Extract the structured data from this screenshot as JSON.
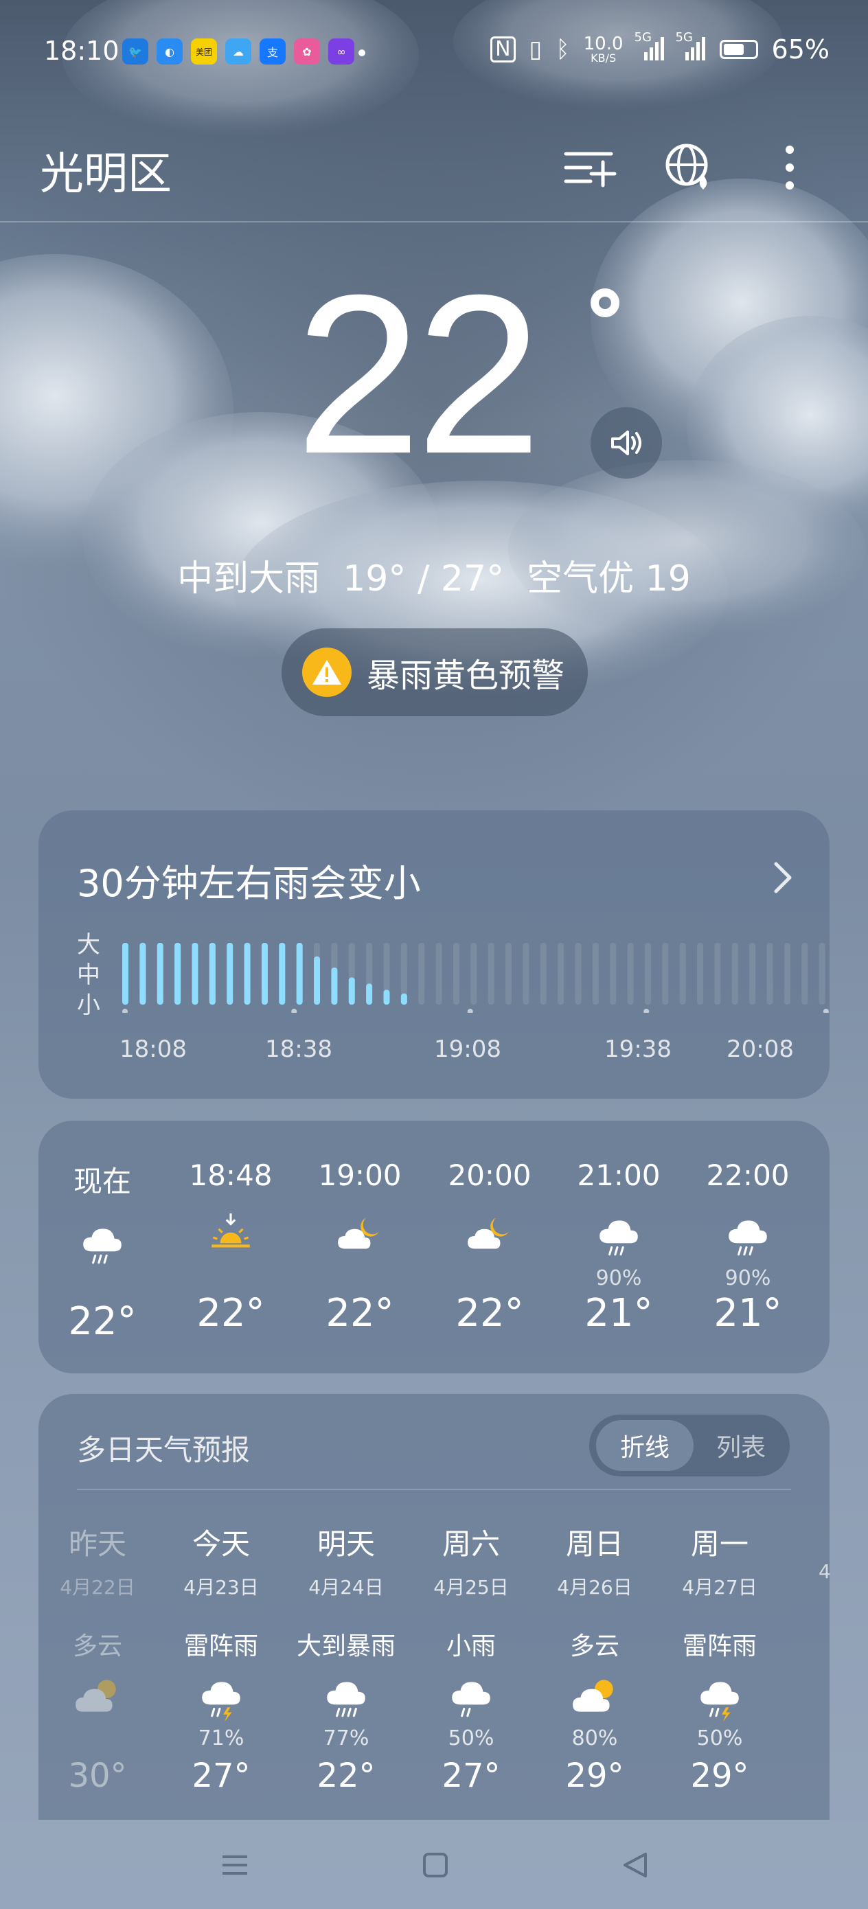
{
  "status": {
    "time": "18:10",
    "apps": [
      {
        "name": "bird-app-icon",
        "color": "#1f7ae0",
        "glyph": "🐦"
      },
      {
        "name": "browser-app-icon",
        "color": "#2a8bf2",
        "glyph": "◐"
      },
      {
        "name": "meituan-app-icon",
        "color": "#f6d000",
        "glyph": "美团"
      },
      {
        "name": "weather-app-icon",
        "color": "#3fa6f3",
        "glyph": "☁"
      },
      {
        "name": "alipay-app-icon",
        "color": "#1677ff",
        "glyph": "支"
      },
      {
        "name": "gallery-app-icon",
        "color": "#e95b9b",
        "glyph": "✿"
      },
      {
        "name": "video-app-icon",
        "color": "#7b3fe4",
        "glyph": "∞"
      }
    ],
    "net_speed_value": "10.0",
    "net_speed_unit": "KB/S",
    "sig1": "5G",
    "sig2": "5G",
    "battery": "65%",
    "battery_level": 0.65
  },
  "header": {
    "city": "光明区"
  },
  "current": {
    "temp": "22",
    "summary": "中到大雨  19° / 27°  空气优 19",
    "alert": "暴雨黄色预警",
    "alert_color": "#f8b81a"
  },
  "rain": {
    "title": "30分钟左右雨会变小",
    "y_labels": [
      "大",
      "中",
      "小"
    ],
    "x_labels": [
      "18:08",
      "18:38",
      "19:08",
      "19:38",
      "20:08"
    ],
    "intensity": [
      1,
      1,
      1,
      1,
      1,
      1,
      1,
      1,
      1,
      1,
      1,
      0.78,
      0.6,
      0.44,
      0.34,
      0.24,
      0.18,
      0,
      0,
      0,
      0,
      0,
      0,
      0,
      0,
      0,
      0,
      0,
      0,
      0,
      0,
      0,
      0,
      0,
      0,
      0,
      0,
      0,
      0,
      0,
      0
    ],
    "bar_color": "#8fdcff"
  },
  "hourly": [
    {
      "time": "现在",
      "icon": "rain-cloud",
      "precip": "",
      "temp": "22°"
    },
    {
      "time": "18:48",
      "icon": "sunset",
      "precip": "",
      "temp": "22°"
    },
    {
      "time": "19:00",
      "icon": "cloudy-night",
      "precip": "",
      "temp": "22°"
    },
    {
      "time": "20:00",
      "icon": "cloudy-night",
      "precip": "",
      "temp": "22°"
    },
    {
      "time": "21:00",
      "icon": "rain-cloud",
      "precip": "90%",
      "temp": "21°"
    },
    {
      "time": "22:00",
      "icon": "rain-cloud",
      "precip": "90%",
      "temp": "21°"
    }
  ],
  "forecast": {
    "title": "多日天气预报",
    "toggle": {
      "active": "折线",
      "inactive": "列表"
    },
    "days": [
      {
        "day": "昨天",
        "date": "4月22日",
        "cond": "多云",
        "icon": "cloudy-day",
        "precip": "",
        "temp": "30°",
        "past": true
      },
      {
        "day": "今天",
        "date": "4月23日",
        "cond": "雷阵雨",
        "icon": "thunder",
        "precip": "71%",
        "temp": "27°"
      },
      {
        "day": "明天",
        "date": "4月24日",
        "cond": "大到暴雨",
        "icon": "heavy-rain",
        "precip": "77%",
        "temp": "22°"
      },
      {
        "day": "周六",
        "date": "4月25日",
        "cond": "小雨",
        "icon": "light-rain",
        "precip": "50%",
        "temp": "27°"
      },
      {
        "day": "周日",
        "date": "4月26日",
        "cond": "多云",
        "icon": "cloudy-day",
        "precip": "80%",
        "temp": "29°"
      },
      {
        "day": "周一",
        "date": "4月27日",
        "cond": "雷阵雨",
        "icon": "thunder",
        "precip": "50%",
        "temp": "29°"
      }
    ],
    "peek_date": "4"
  }
}
